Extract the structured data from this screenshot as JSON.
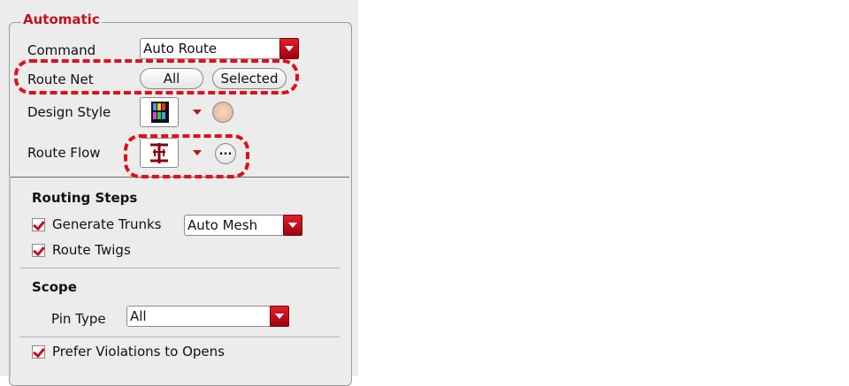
{
  "group": {
    "title": "Automatic"
  },
  "command": {
    "label": "Command",
    "value": "Auto Route"
  },
  "route_net": {
    "label": "Route Net",
    "all": "All",
    "selected": "Selected"
  },
  "design_style": {
    "label": "Design Style"
  },
  "route_flow": {
    "label": "Route Flow",
    "more": "..."
  },
  "routing_steps": {
    "title": "Routing Steps",
    "generate_trunks": {
      "label": "Generate Trunks",
      "checked": true,
      "mode": "Auto Mesh"
    },
    "route_twigs": {
      "label": "Route Twigs",
      "checked": true
    }
  },
  "scope": {
    "title": "Scope",
    "pin_type": {
      "label": "Pin Type",
      "value": "All"
    }
  },
  "prefer_violations": {
    "label": "Prefer Violations to Opens",
    "checked": true
  },
  "colors": {
    "accent": "#c8101a",
    "highlight": "#e0101a",
    "panel": "#ececec"
  }
}
